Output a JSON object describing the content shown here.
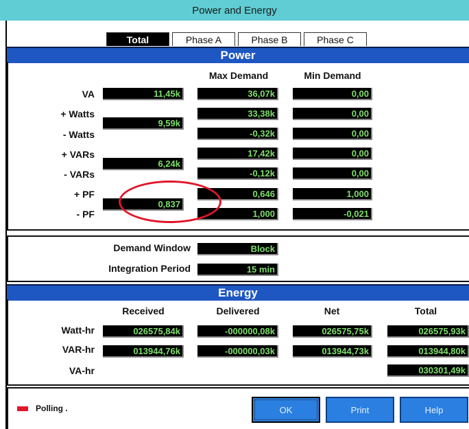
{
  "window": {
    "title": "Power and Energy"
  },
  "tabs": [
    "Total",
    "Phase A",
    "Phase B",
    "Phase C"
  ],
  "power": {
    "section_title": "Power",
    "headers": {
      "max": "Max Demand",
      "min": "Min Demand"
    },
    "labels": {
      "va": "VA",
      "plus_watts": "+ Watts",
      "minus_watts": "- Watts",
      "plus_vars": "+ VARs",
      "minus_vars": "- VARs",
      "plus_pf": "+ PF",
      "minus_pf": "- PF"
    },
    "values": {
      "va": "11,45k",
      "va_max": "36,07k",
      "va_min": "0,00",
      "watts": "9,59k",
      "plus_watts_max": "33,38k",
      "plus_watts_min": "0,00",
      "minus_watts_max": "-0,32k",
      "minus_watts_min": "0,00",
      "vars": "6,24k",
      "plus_vars_max": "17,42k",
      "plus_vars_min": "0,00",
      "minus_vars_max": "-0,12k",
      "minus_vars_min": "0,00",
      "pf": "0,837",
      "plus_pf_max": "0,646",
      "plus_pf_min": "1,000",
      "minus_pf_max": "1,000",
      "minus_pf_min": "-0,021"
    }
  },
  "demand": {
    "window_label": "Demand Window",
    "window_value": "Block",
    "period_label": "Integration Period",
    "period_value": "15 min"
  },
  "energy": {
    "section_title": "Energy",
    "headers": {
      "received": "Received",
      "delivered": "Delivered",
      "net": "Net",
      "total": "Total"
    },
    "rows": {
      "watt_hr": {
        "label": "Watt-hr",
        "received": "026575,84k",
        "delivered": "-000000,08k",
        "net": "026575,75k",
        "total": "026575,93k"
      },
      "var_hr": {
        "label": "VAR-hr",
        "received": "013944,76k",
        "delivered": "-000000,03k",
        "net": "013944,73k",
        "total": "013944,80k"
      },
      "va_hr": {
        "label": "VA-hr",
        "total": "030301,49k"
      }
    }
  },
  "status": {
    "text": "Polling .",
    "led_color": "#e0162a"
  },
  "buttons": {
    "ok": "OK",
    "print": "Print",
    "help": "Help"
  },
  "colors": {
    "title_bar": "#5fcdd3",
    "section_bar": "#1e57c2",
    "value_text": "#7ee06b",
    "button": "#2a7fe0"
  }
}
